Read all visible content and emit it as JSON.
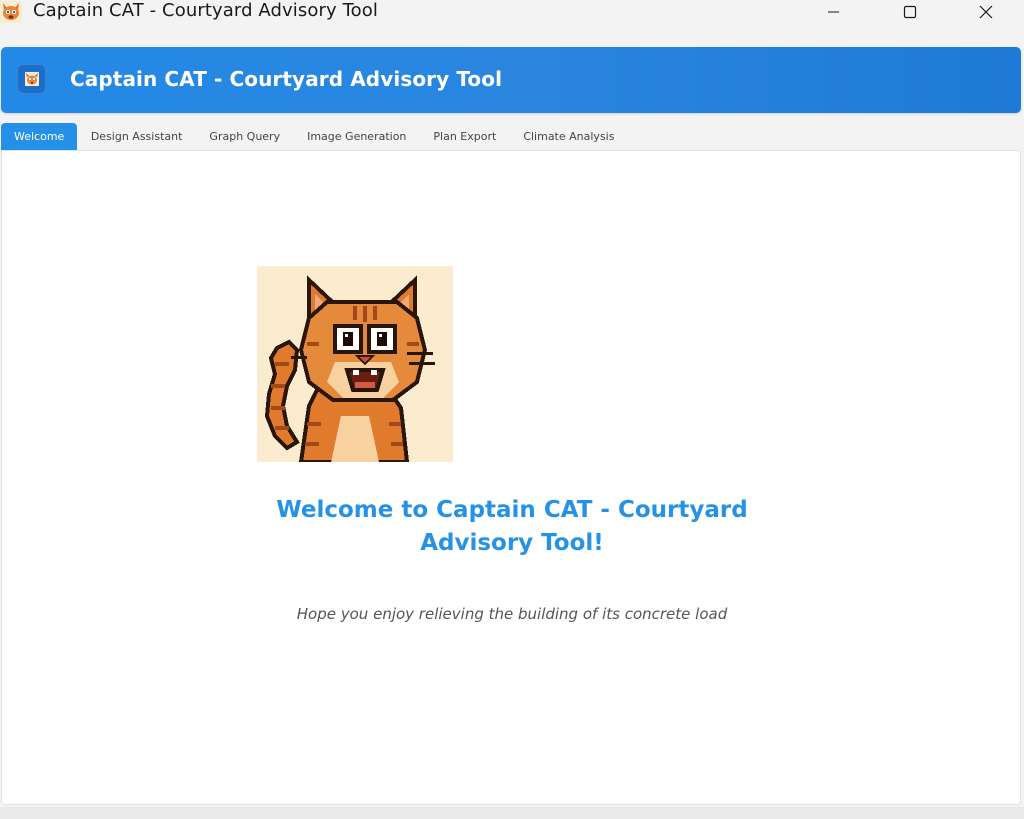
{
  "window": {
    "title": "Captain CAT - Courtyard Advisory Tool",
    "controls": [
      "minimize-icon",
      "maximize-icon",
      "close-icon"
    ]
  },
  "header": {
    "title": "Captain CAT - Courtyard Advisory Tool",
    "logo_icon": "cat-logo-icon"
  },
  "tabs": [
    {
      "label": "Welcome",
      "active": true
    },
    {
      "label": "Design Assistant",
      "active": false
    },
    {
      "label": "Graph Query",
      "active": false
    },
    {
      "label": "Image Generation",
      "active": false
    },
    {
      "label": "Plan Export",
      "active": false
    },
    {
      "label": "Climate Analysis",
      "active": false
    }
  ],
  "welcome": {
    "image": "pixel-art-waving-cat",
    "title": "Welcome to Captain CAT - Courtyard Advisory Tool!",
    "subtitle": "Hope you enjoy relieving the building of its concrete load"
  },
  "colors": {
    "accent": "#2590e8",
    "header": "#2389e6",
    "title_text": "#2592e6"
  }
}
